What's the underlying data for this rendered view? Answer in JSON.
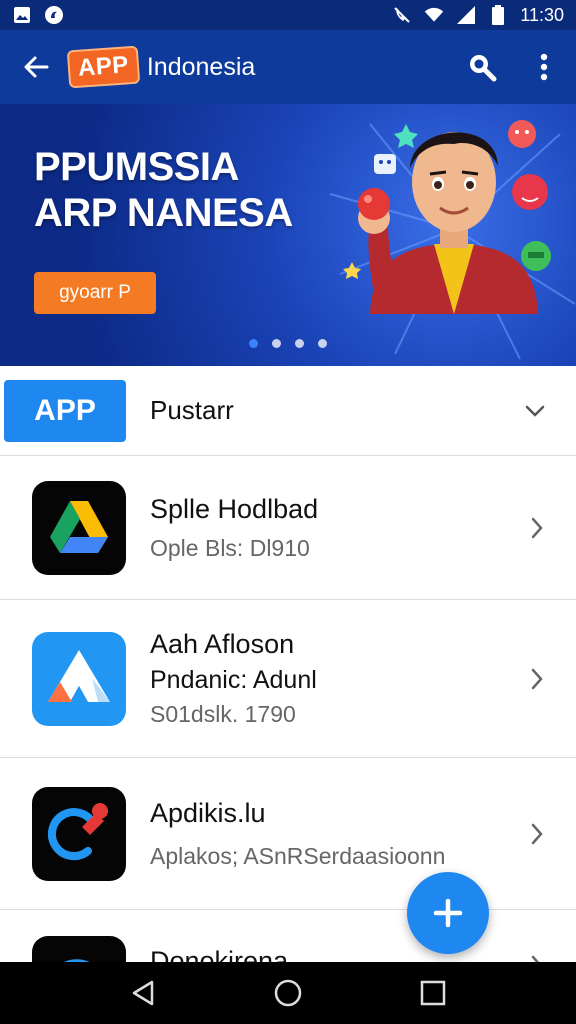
{
  "status_bar": {
    "time": "11:30",
    "icons": [
      "gallery-icon",
      "notification-icon",
      "mute-icon",
      "wifi-icon",
      "signal-icon",
      "battery-icon"
    ]
  },
  "app_bar": {
    "logo_text": "APP",
    "title": "Indonesia",
    "icons": [
      "back-arrow-icon",
      "search-icon",
      "more-vert-icon"
    ]
  },
  "banner": {
    "headline_line1": "PPUMSSIA",
    "headline_line2": "ARP NANESA",
    "cta_label": "gyoarr P",
    "page_count": 4,
    "active_page": 0
  },
  "category": {
    "badge": "APP",
    "label": "Pustarr"
  },
  "apps": [
    {
      "name": "Splle Hodlbad",
      "subtitles": [
        "Ople Bls: Dl910"
      ],
      "icon": "drive-style-icon"
    },
    {
      "name": "Aah Afloson",
      "subtitles": [
        "Pndanic: Adunl",
        "S01dslk. 1790"
      ],
      "icon": "triangle-logo-icon"
    },
    {
      "name": "Apdikis.lu",
      "subtitles": [
        "Aplakos; ASnRSerdaasioonn"
      ],
      "icon": "cleanup-arc-icon"
    },
    {
      "name": "Donokirena",
      "subtitles": [],
      "icon": "partial-app-icon"
    }
  ],
  "colors": {
    "primary": "#0d3a9b",
    "accent": "#1e88f0",
    "cta": "#f57a24",
    "logo": "#f26522"
  },
  "nav": {
    "icons": [
      "nav-back-icon",
      "nav-home-icon",
      "nav-recents-icon"
    ]
  }
}
